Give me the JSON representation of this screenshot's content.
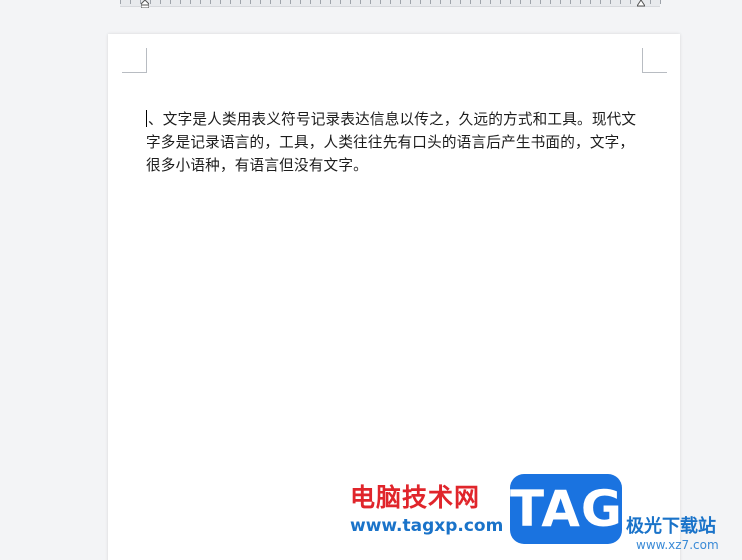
{
  "document": {
    "paragraph": "、文字是人类用表义符号记录表达信息以传之，久远的方式和工具。现代文字多是记录语言的，工具，人类往往先有口头的语言后产生书面的，文字，很多小语种，有语言但没有文字。"
  },
  "watermark": {
    "site_name_cn": "电脑技术网",
    "site_url": "www.tagxp.com",
    "logo_text": "TAG",
    "partner_name": "极光下载站",
    "partner_url": "www.xz7.com"
  },
  "colors": {
    "workspace_bg": "#f3f4f6",
    "page_bg": "#ffffff",
    "text": "#1c1c1c",
    "watermark_red": "#e0252b",
    "watermark_blue": "#1a73e0"
  },
  "icons": {
    "ruler_left_indent": "left-indent-marker-icon",
    "ruler_right_indent": "right-indent-marker-icon"
  }
}
